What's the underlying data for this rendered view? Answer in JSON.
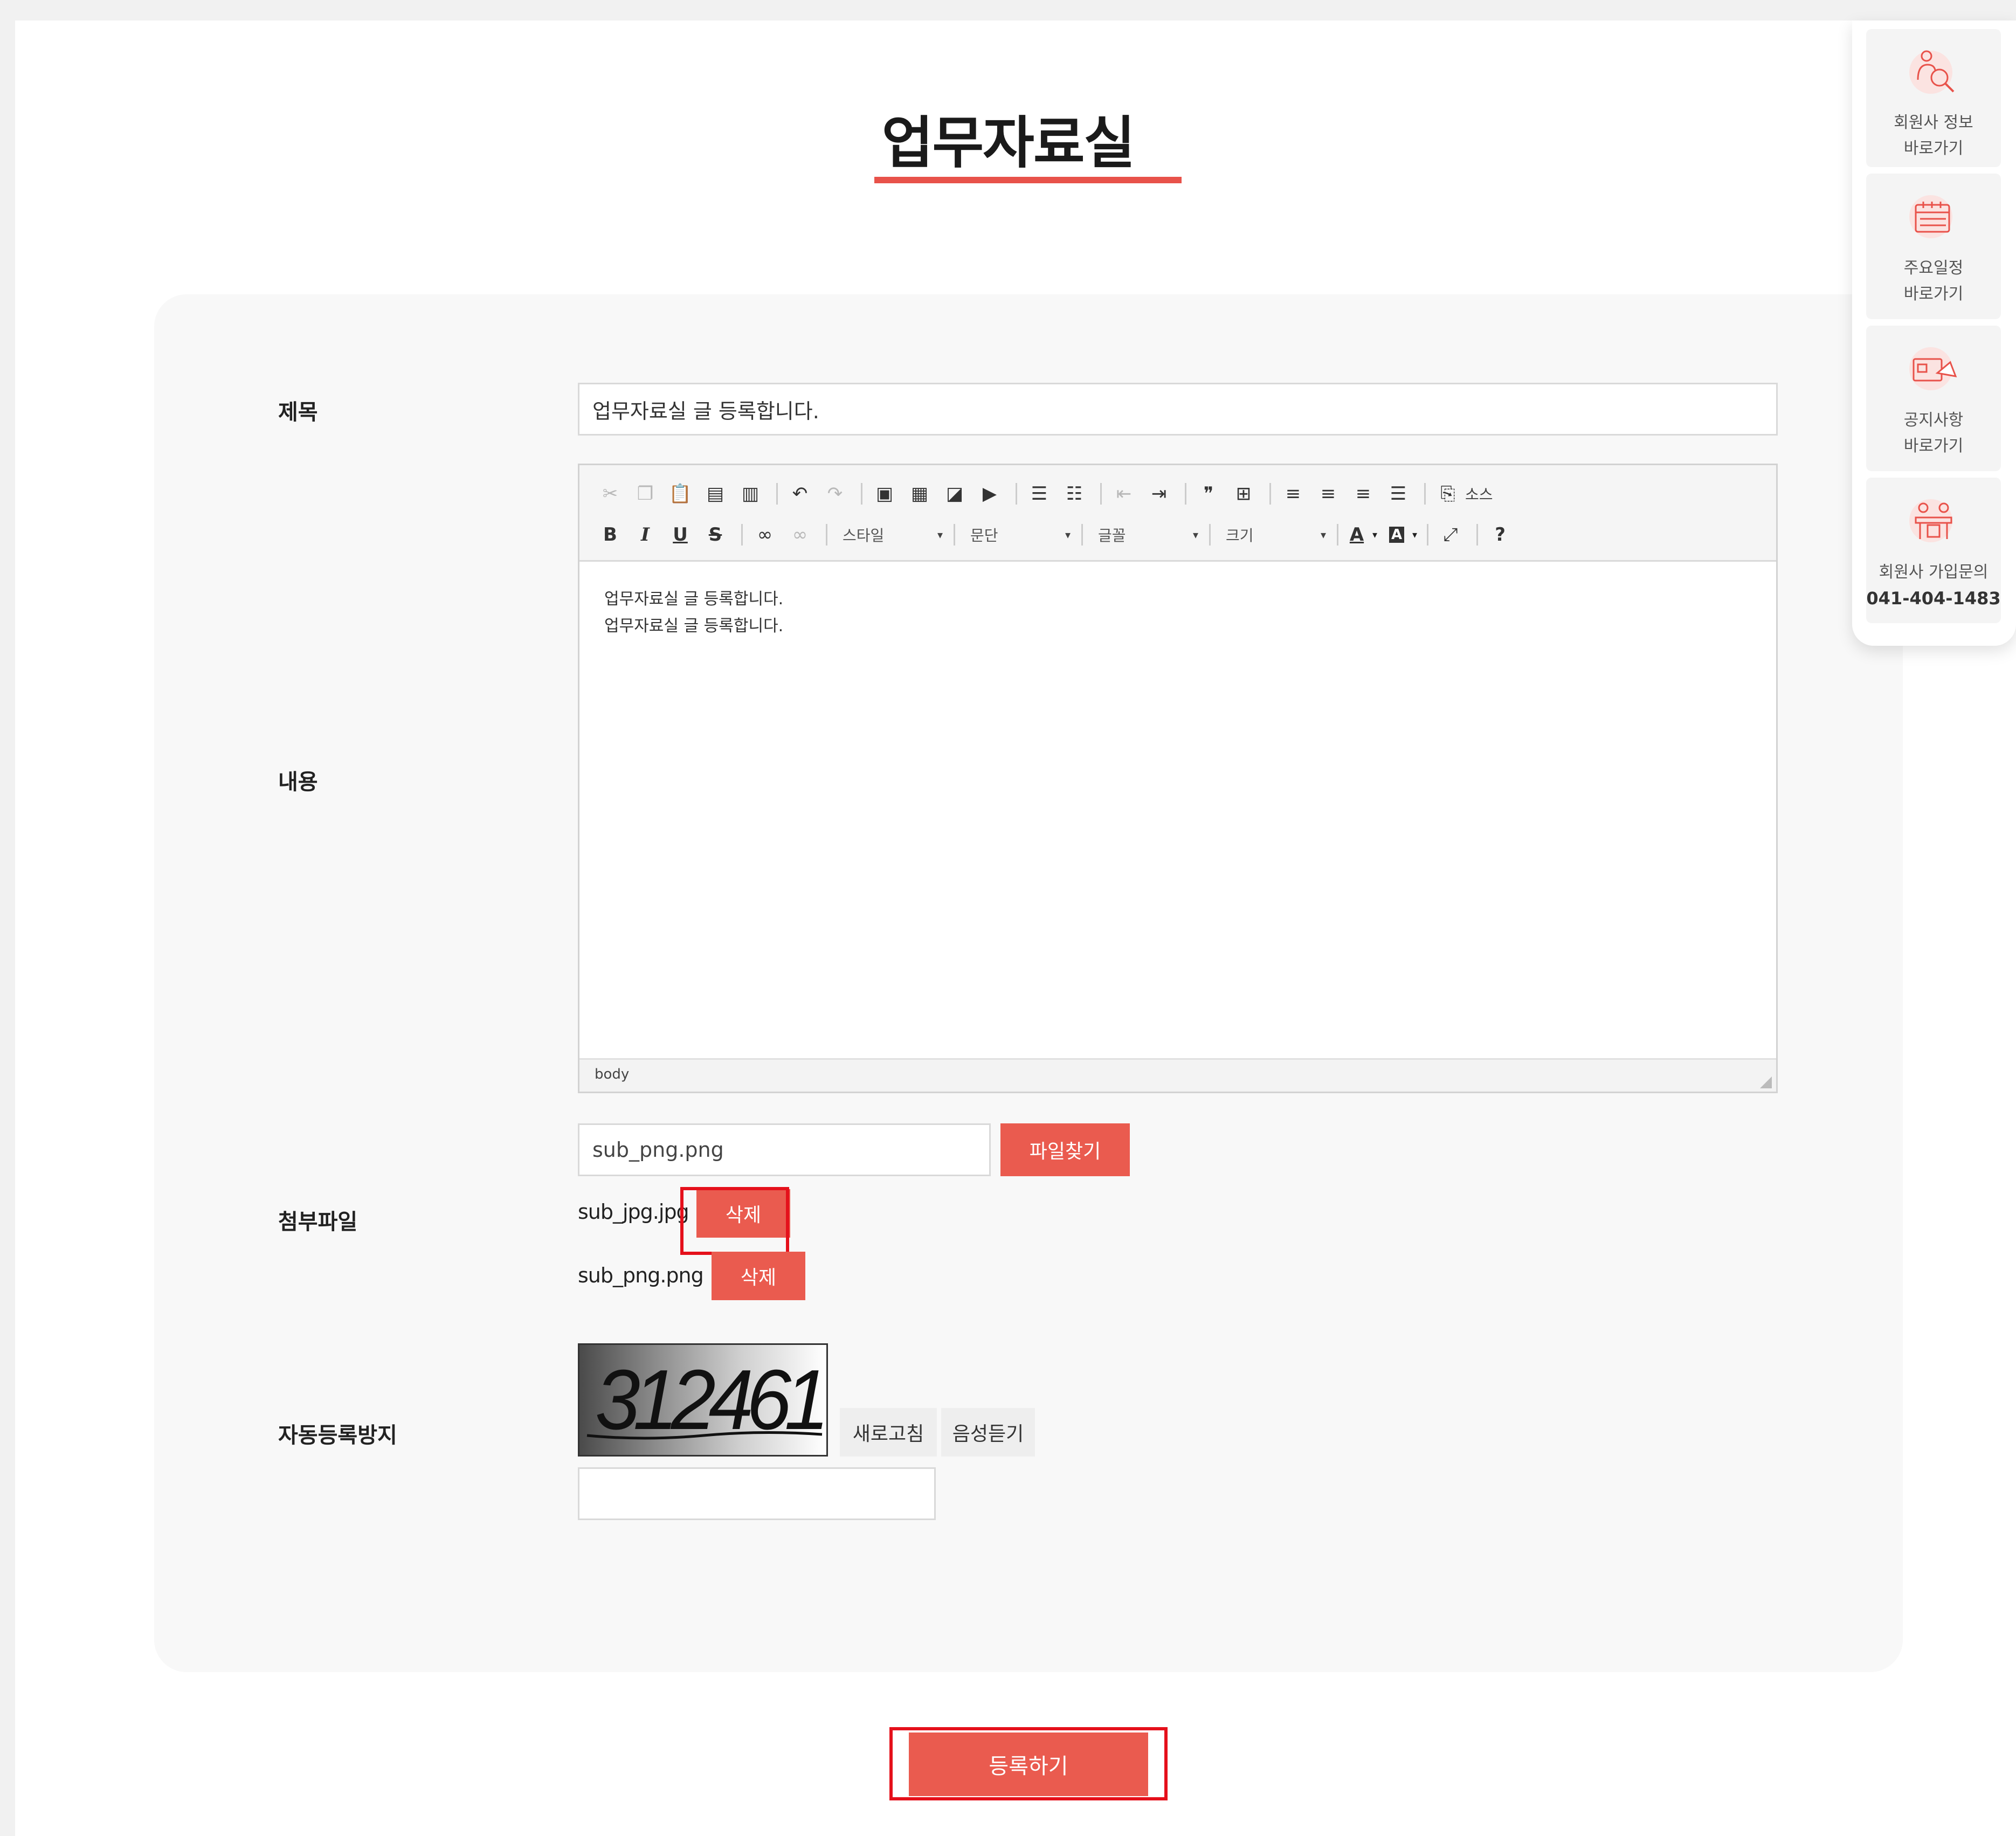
{
  "page": {
    "title": "업무자료실"
  },
  "form": {
    "subject": {
      "label": "제목",
      "value": "업무자료실 글 등록합니다."
    },
    "content": {
      "label": "내용",
      "lines": [
        "업무자료실 글 등록합니다.",
        "업무자료실 글 등록합니다."
      ],
      "status_path": "body",
      "toolbar": {
        "row1": [
          "cut-icon",
          "copy-icon",
          "paste-icon",
          "paste-text-icon",
          "paste-word-icon",
          "undo-icon",
          "redo-icon",
          "image-icon",
          "table-icon",
          "image-upload-icon",
          "youtube-icon",
          "ordered-list-icon",
          "unordered-list-icon",
          "outdent-icon",
          "indent-icon",
          "blockquote-icon",
          "div-icon",
          "align-left-icon",
          "align-center-icon",
          "align-right-icon",
          "align-justify-icon",
          "source-icon"
        ],
        "source_label": "소스",
        "row2": [
          "bold-icon",
          "italic-icon",
          "underline-icon",
          "strikethrough-icon",
          "link-icon",
          "unlink-icon"
        ],
        "combos": {
          "style": "스타일",
          "paragraph": "문단",
          "font": "글꼴",
          "size": "크기"
        }
      }
    },
    "attachment": {
      "label": "첨부파일",
      "input_value": "sub_png.png",
      "browse_label": "파일찾기",
      "files": [
        {
          "name": "sub_jpg.jpg",
          "delete_label": "삭제"
        },
        {
          "name": "sub_png.png",
          "delete_label": "삭제"
        }
      ]
    },
    "captcha": {
      "label": "자동등록방지",
      "code": "312461",
      "refresh_label": "새로고침",
      "audio_label": "음성듣기",
      "input_value": ""
    },
    "submit_label": "등록하기"
  },
  "quick_menu": [
    {
      "icon": "member-search-icon",
      "line1": "회원사 정보",
      "line2": "바로가기"
    },
    {
      "icon": "calendar-icon",
      "line1": "주요일정",
      "line2": "바로가기"
    },
    {
      "icon": "notice-megaphone-icon",
      "line1": "공지사항",
      "line2": "바로가기"
    },
    {
      "icon": "membership-inquiry-icon",
      "line1": "회원사 가입문의",
      "line2": "041-404-1483"
    }
  ],
  "colors": {
    "accent": "#ea5b4f",
    "highlight": "#e5101b",
    "panel": "#f8f8f8"
  }
}
